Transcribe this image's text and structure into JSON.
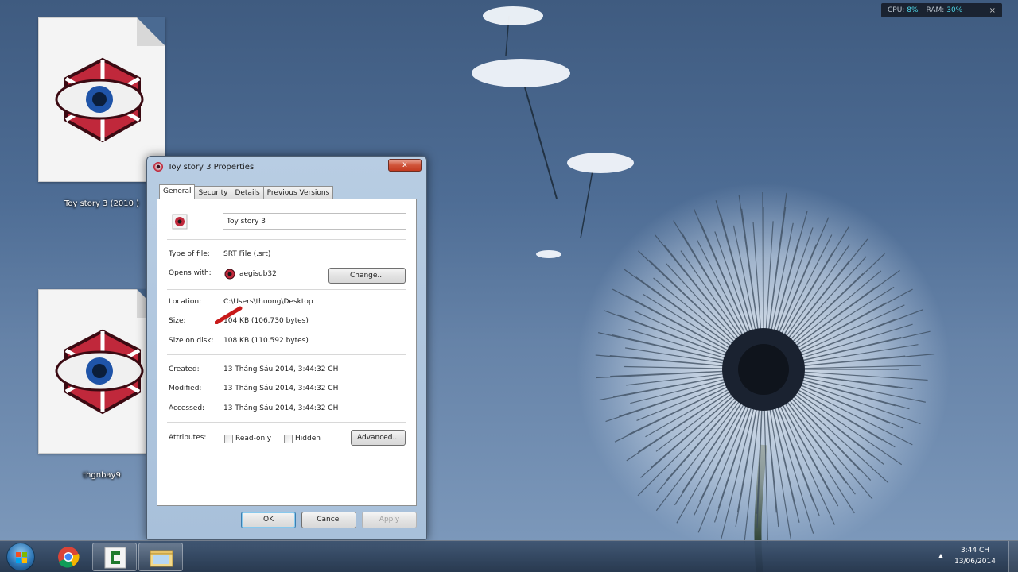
{
  "desktop": {
    "icons": [
      {
        "label": "Toy story 3 (2010 )"
      },
      {
        "label": "thgnbay9"
      }
    ]
  },
  "sysmon": {
    "cpu_label": "CPU:",
    "cpu_value": "8%",
    "ram_label": "RAM:",
    "ram_value": "30%",
    "close": "×"
  },
  "window": {
    "title": "Toy story 3 Properties",
    "close": "x",
    "tabs": [
      {
        "label": "General",
        "active": true
      },
      {
        "label": "Security"
      },
      {
        "label": "Details"
      },
      {
        "label": "Previous Versions"
      }
    ],
    "name_value": "Toy story 3",
    "type_label": "Type of file:",
    "type_value": "SRT File (.srt)",
    "opens_label": "Opens with:",
    "opens_value": "aegisub32",
    "change_button": "Change...",
    "location_label": "Location:",
    "location_value": "C:\\Users\\thuong\\Desktop",
    "size_label": "Size:",
    "size_value": "104 KB (106.7​30 bytes)",
    "size_on_disk_label": "Size on disk:",
    "size_on_disk_value": "108 KB (110.592 bytes)",
    "created_label": "Created:",
    "created_value": "13 Tháng Sáu 2014, 3:44:32 CH",
    "modified_label": "Modified:",
    "modified_value": "13 Tháng Sáu 2014, 3:44:32 CH",
    "accessed_label": "Accessed:",
    "accessed_value": "13 Tháng Sáu 2014, 3:44:32 CH",
    "attributes_label": "Attributes:",
    "readonly_label": "Read-only",
    "hidden_label": "Hidden",
    "advanced_button": "Advanced...",
    "ok_button": "OK",
    "cancel_button": "Cancel",
    "apply_button": "Apply"
  },
  "taskbar": {
    "time": "3:44 CH",
    "date": "13/06/2014",
    "tray_arrow": "▲"
  },
  "colors": {
    "accent": "#c0283b",
    "highlight": "#4fd6e8"
  }
}
